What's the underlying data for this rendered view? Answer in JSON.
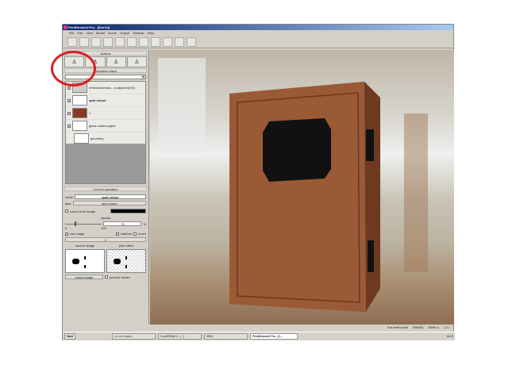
{
  "window": {
    "title": "PrintDevizer2 Pro - [Eve'es]"
  },
  "menu": [
    "File",
    "Edit",
    "View",
    "Model",
    "Scene",
    "Output",
    "Window",
    "Help"
  ],
  "panel": {
    "actions_header": "Actions",
    "stack_header": "Operation stack",
    "layers": [
      {
        "label": "emboss/deboss - sculptured(3D)",
        "checked": true
      },
      {
        "label": "spot colour",
        "checked": true
      },
      {
        "label": "1",
        "checked": true
      },
      {
        "label": "gloss coated paper",
        "checked": true
      },
      {
        "label": "geometry",
        "checked": false
      }
    ],
    "current_header": "Current operation",
    "name_label": "name",
    "name_value": "spot colour",
    "type_label": "type",
    "type_value": "spot colour",
    "colour_from_image": "colour from image",
    "opacity_label": "opacity",
    "opacity_value": "70",
    "opacity_unit": "%",
    "slider_min": "0",
    "slider_max": "100",
    "use_image": "use image",
    "halftone": "halftone",
    "invert": "invert",
    "button_2": "2",
    "source_image": "source image",
    "print_effect": "print effect",
    "reload_image": "reload image",
    "prevent_reload": "prevent reload"
  },
  "status": [
    "Flat sheet model",
    "996x893",
    "26MB 1x",
    "2.2.1"
  ],
  "taskbar": {
    "start": "Start",
    "items": [
      "תמונות לכריכה...",
      "CorelDRAW 9 - [...]",
      "5555",
      "PrintDevizer2 Pro - [t..."
    ],
    "clock": "16:22"
  },
  "colors": {
    "accent": "#d82020",
    "book": "#9a5a36"
  }
}
